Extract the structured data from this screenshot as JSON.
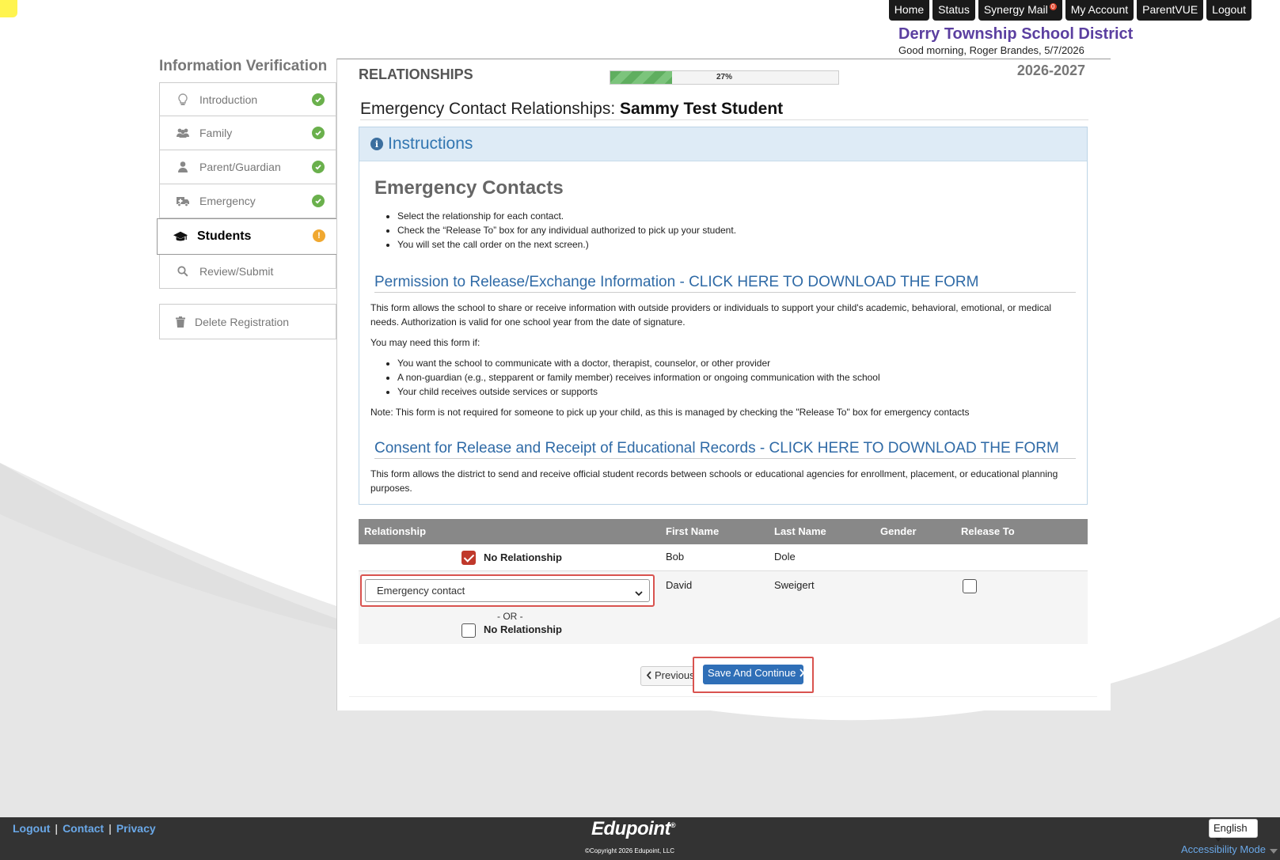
{
  "topnav": {
    "home": "Home",
    "status": "Status",
    "synergy_mail": "Synergy Mail",
    "mail_badge": "0",
    "my_account": "My Account",
    "parentvue": "ParentVUE",
    "logout": "Logout"
  },
  "header": {
    "district": "Derry Township School District",
    "greeting": "Good morning, Roger Brandes, 5/7/2026"
  },
  "sidebar": {
    "title": "Information Verification",
    "items": [
      {
        "label": "Introduction",
        "icon": "lightbulb-icon",
        "status": "complete"
      },
      {
        "label": "Family",
        "icon": "users-icon",
        "status": "complete"
      },
      {
        "label": "Parent/Guardian",
        "icon": "user-icon",
        "status": "complete"
      },
      {
        "label": "Emergency",
        "icon": "ambulance-icon",
        "status": "complete"
      },
      {
        "label": "Students",
        "icon": "graduation-cap-icon",
        "status": "warning"
      },
      {
        "label": "Review/Submit",
        "icon": "search-icon",
        "status": "none"
      }
    ],
    "delete_label": "Delete Registration"
  },
  "main": {
    "section_title": "RELATIONSHIPS",
    "progress_value": 27,
    "progress_label": "27%",
    "school_year": "2026-2027",
    "heading_prefix": "Emergency Contact Relationships:",
    "student_name": "Sammy Test Student",
    "instructions": {
      "header": "Instructions",
      "title": "Emergency Contacts",
      "bullets": [
        "Select the relationship for each contact.",
        "Check the “Release To” box for any individual authorized to pick up your student.",
        "You will set the call order on the next screen.)"
      ],
      "permission_heading": "Permission to Release/Exchange Information - CLICK HERE TO DOWNLOAD THE FORM",
      "permission_text": "This form allows the school to share or receive information with outside providers or individuals to support your child's academic, behavioral, emotional, or medical needs. Authorization is valid for one school year from the date of signature.",
      "need_intro": "You may need this form if:",
      "need_bullets": [
        "You want the school to communicate with a doctor, therapist, counselor, or other provider",
        "A non-guardian (e.g., stepparent or family member) receives information or ongoing communication with the school",
        "Your child receives outside services or supports"
      ],
      "note": "Note:  This form is not required for someone to pick up your child, as this is managed by checking the \"Release To\" box for emergency contacts",
      "consent_heading": "Consent for Release and Receipt of Educational Records - CLICK HERE TO DOWNLOAD THE FORM",
      "consent_text": "This form allows the district to send and receive official student records between schools or educational agencies for enrollment, placement, or educational planning purposes."
    },
    "table": {
      "columns": [
        "Relationship",
        "First Name",
        "Last Name",
        "Gender",
        "Release To"
      ],
      "rows": [
        {
          "no_relationship_label": "No Relationship",
          "no_relationship_checked": true,
          "first": "Bob",
          "last": "Dole",
          "gender": ""
        },
        {
          "relationship_value": "Emergency contact",
          "or_label": "- OR -",
          "no_relationship_label": "No Relationship",
          "no_relationship_checked": false,
          "first": "David",
          "last": "Sweigert",
          "gender": "",
          "release_to": false
        }
      ]
    },
    "buttons": {
      "previous": "Previous",
      "save_continue": "Save And Continue"
    }
  },
  "footer": {
    "links": [
      "Logout",
      "Contact",
      "Privacy"
    ],
    "brand": "Edupoint",
    "brand_mark": "®",
    "copyright": "©Copyright 2026 Edupoint, LLC",
    "language": "English",
    "accessibility": "Accessibility Mode"
  }
}
